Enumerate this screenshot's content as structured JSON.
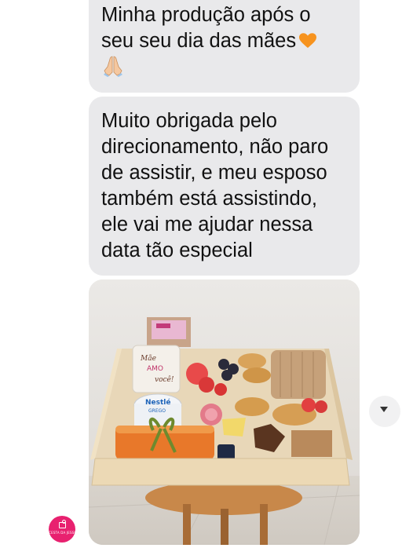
{
  "messages": [
    {
      "lines": [
        "Minha produção após o",
        "seu seu dia das mães"
      ],
      "trailing_icon": "orange-heart-icon",
      "second_icon": "folded-hands-icon"
    },
    {
      "lines": [
        "Muito obrigada pelo",
        "direcionamento, não paro",
        "de assistir, e meu esposo",
        "também está assistindo,",
        "ele vai me ajudar nessa",
        "data tão especial"
      ]
    }
  ],
  "photo": {
    "description_icon": "breakfast-tray-photo",
    "mug_text": [
      "Mãe",
      "AMO",
      "você!"
    ],
    "yogurt_brand": "Nestlé",
    "yogurt_type": "GREGO"
  },
  "avatar": {
    "text": "CESTA DA JESSI"
  },
  "colors": {
    "bubble": "#e9e9eb",
    "avatar": "#e8216f",
    "heart": "#f7931e"
  }
}
